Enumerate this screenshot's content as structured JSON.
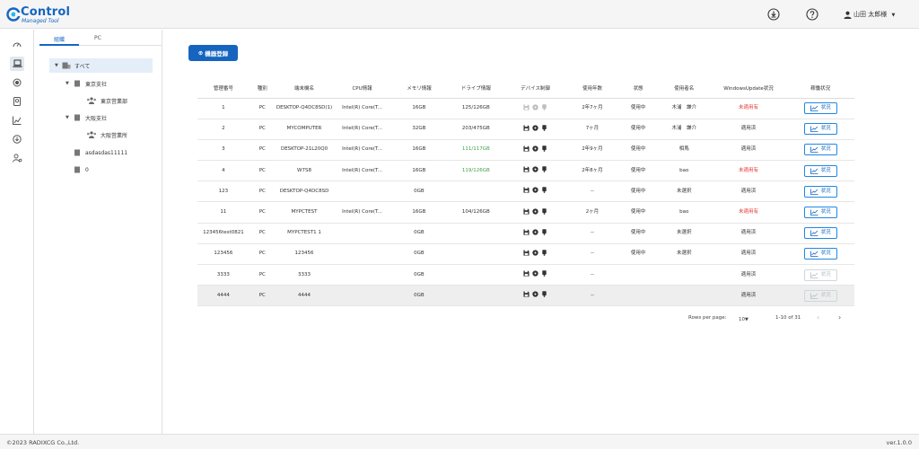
{
  "header": {
    "brand": "Control",
    "brand_sub": "Managed Tool",
    "user_name": "山田 太郎様"
  },
  "tree": {
    "tabs": [
      "組織",
      "PC"
    ],
    "nodes": [
      "すべて",
      "東京支社",
      "東京営業部",
      "大阪支社",
      "大阪営業所",
      "asdasdas11111",
      "0"
    ]
  },
  "main": {
    "register_button": "機器登録",
    "columns": [
      "管理番号",
      "種別",
      "端末機名",
      "CPU情報",
      "メモリ情報",
      "ドライブ情報",
      "デバイス制御",
      "使用年数",
      "状態",
      "使用者名",
      "WindowsUpdate状況",
      "稼働状況"
    ],
    "status_button_label": "状況",
    "rows": [
      {
        "id": "1",
        "type": "PC",
        "name": "DESKTOP-Q4DC8SD(1)",
        "cpu": "Intel(R) Core(T...",
        "mem": "16GB",
        "drive": "125/126GB",
        "years": "2年7ヶ月",
        "state": "使用中",
        "user": "木浦　謙介",
        "wu": "未適用有",
        "wu_status": "red",
        "drive_status": "",
        "dev_enabled": false,
        "btn_enabled": true
      },
      {
        "id": "2",
        "type": "PC",
        "name": "MYCOMPUTER",
        "cpu": "Intel(R) Core(T...",
        "mem": "32GB",
        "drive": "203/475GB",
        "years": "7ヶ月",
        "state": "使用中",
        "user": "木浦　謙介",
        "wu": "適用済",
        "wu_status": "",
        "drive_status": "",
        "dev_enabled": true,
        "btn_enabled": true
      },
      {
        "id": "3",
        "type": "PC",
        "name": "DESKTOP-21L20Q0",
        "cpu": "Intel(R) Core(T...",
        "mem": "16GB",
        "drive": "111/117GB",
        "years": "2年9ヶ月",
        "state": "使用中",
        "user": "相馬",
        "wu": "適用済",
        "wu_status": "",
        "drive_status": "green",
        "dev_enabled": true,
        "btn_enabled": true
      },
      {
        "id": "4",
        "type": "PC",
        "name": "W7S8",
        "cpu": "Intel(R) Core(T...",
        "mem": "16GB",
        "drive": "119/126GB",
        "years": "2年8ヶ月",
        "state": "使用中",
        "user": "bao",
        "wu": "未適用有",
        "wu_status": "red",
        "drive_status": "green",
        "dev_enabled": true,
        "btn_enabled": true
      },
      {
        "id": "123",
        "type": "PC",
        "name": "DESKTOP-Q4DC8SD",
        "cpu": "",
        "mem": "0GB",
        "drive": "",
        "years": "--",
        "state": "使用中",
        "user": "未選択",
        "wu": "適用済",
        "wu_status": "",
        "drive_status": "",
        "dev_enabled": true,
        "btn_enabled": true
      },
      {
        "id": "11",
        "type": "PC",
        "name": "MYPCTEST",
        "cpu": "Intel(R) Core(T...",
        "mem": "16GB",
        "drive": "104/126GB",
        "years": "2ヶ月",
        "state": "使用中",
        "user": "bao",
        "wu": "未適用有",
        "wu_status": "red",
        "drive_status": "",
        "dev_enabled": true,
        "btn_enabled": true
      },
      {
        "id": "123456test0821",
        "type": "PC",
        "name": "MYPCTEST1 1",
        "cpu": "",
        "mem": "0GB",
        "drive": "",
        "years": "--",
        "state": "使用中",
        "user": "未選択",
        "wu": "適用済",
        "wu_status": "",
        "drive_status": "",
        "dev_enabled": true,
        "btn_enabled": true
      },
      {
        "id": "123456",
        "type": "PC",
        "name": "123456",
        "cpu": "",
        "mem": "0GB",
        "drive": "",
        "years": "--",
        "state": "使用中",
        "user": "未選択",
        "wu": "適用済",
        "wu_status": "",
        "drive_status": "",
        "dev_enabled": true,
        "btn_enabled": true
      },
      {
        "id": "3333",
        "type": "PC",
        "name": "3333",
        "cpu": "",
        "mem": "0GB",
        "drive": "",
        "years": "--",
        "state": "",
        "user": "",
        "wu": "適用済",
        "wu_status": "",
        "drive_status": "",
        "dev_enabled": true,
        "btn_enabled": false
      },
      {
        "id": "4444",
        "type": "PC",
        "name": "4444",
        "cpu": "",
        "mem": "0GB",
        "drive": "",
        "years": "--",
        "state": "",
        "user": "",
        "wu": "適用済",
        "wu_status": "",
        "drive_status": "",
        "dev_enabled": true,
        "btn_enabled": false,
        "highlight": true
      }
    ],
    "pager": {
      "rows_per_page_label": "Rows per page:",
      "rows_per_page": "10",
      "range": "1-10 of 31"
    }
  },
  "footer": {
    "copyright": "©2023 RADIXCG Co.,Ltd.",
    "version": "ver.1.0.0"
  },
  "colors": {
    "accent": "#1565c0",
    "warning_text": "#e53935",
    "ok_drive_text": "#43a047"
  }
}
